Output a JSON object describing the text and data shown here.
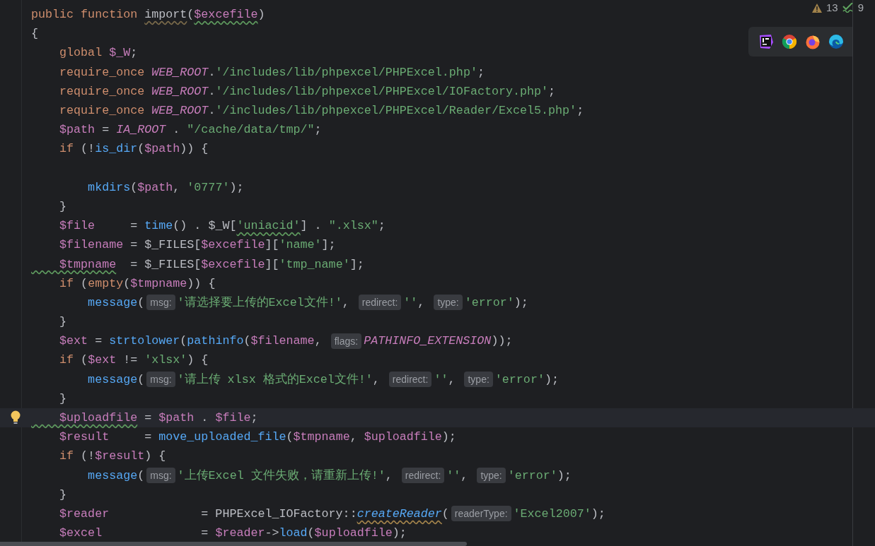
{
  "inspections": {
    "warnings": "13",
    "checks": "9"
  },
  "lines": [
    {
      "current": false,
      "tokens": [
        {
          "kind": "keyword",
          "text": "public function "
        },
        {
          "kind": "plain-weak",
          "text": "import"
        },
        {
          "kind": "plain",
          "text": "("
        },
        {
          "kind": "variable-typo",
          "text": "$excefile"
        },
        {
          "kind": "plain",
          "text": ")"
        }
      ]
    },
    {
      "current": false,
      "tokens": [
        {
          "kind": "plain",
          "text": "{"
        }
      ]
    },
    {
      "current": false,
      "tokens": [
        {
          "kind": "keyword",
          "text": "    global "
        },
        {
          "kind": "variable",
          "text": "$_W"
        },
        {
          "kind": "plain",
          "text": ";"
        }
      ]
    },
    {
      "current": false,
      "tokens": [
        {
          "kind": "keyword",
          "text": "    require_once "
        },
        {
          "kind": "constant",
          "text": "WEB_ROOT"
        },
        {
          "kind": "plain",
          "text": "."
        },
        {
          "kind": "string",
          "text": "'/includes/lib/phpexcel/PHPExcel.php'"
        },
        {
          "kind": "plain",
          "text": ";"
        }
      ]
    },
    {
      "current": false,
      "tokens": [
        {
          "kind": "keyword",
          "text": "    require_once "
        },
        {
          "kind": "constant",
          "text": "WEB_ROOT"
        },
        {
          "kind": "plain",
          "text": "."
        },
        {
          "kind": "string",
          "text": "'/includes/lib/phpexcel/PHPExcel/IOFactory.php'"
        },
        {
          "kind": "plain",
          "text": ";"
        }
      ]
    },
    {
      "current": false,
      "tokens": [
        {
          "kind": "keyword",
          "text": "    require_once "
        },
        {
          "kind": "constant",
          "text": "WEB_ROOT"
        },
        {
          "kind": "plain",
          "text": "."
        },
        {
          "kind": "string",
          "text": "'/includes/lib/phpexcel/PHPExcel/Reader/Excel5.php'"
        },
        {
          "kind": "plain",
          "text": ";"
        }
      ]
    },
    {
      "current": false,
      "tokens": [
        {
          "kind": "variable",
          "text": "    $path"
        },
        {
          "kind": "plain",
          "text": " = "
        },
        {
          "kind": "constant",
          "text": "IA_ROOT"
        },
        {
          "kind": "plain",
          "text": " . "
        },
        {
          "kind": "string",
          "text": "\"/cache/data/tmp/\""
        },
        {
          "kind": "plain",
          "text": ";"
        }
      ]
    },
    {
      "current": false,
      "tokens": [
        {
          "kind": "keyword",
          "text": "    if "
        },
        {
          "kind": "plain",
          "text": "(!"
        },
        {
          "kind": "function",
          "text": "is_dir"
        },
        {
          "kind": "plain",
          "text": "("
        },
        {
          "kind": "variable",
          "text": "$path"
        },
        {
          "kind": "plain",
          "text": ")) {"
        }
      ]
    },
    {
      "current": false
    },
    {
      "current": false,
      "tokens": [
        {
          "kind": "function",
          "text": "        mkdirs"
        },
        {
          "kind": "plain",
          "text": "("
        },
        {
          "kind": "variable",
          "text": "$path"
        },
        {
          "kind": "plain",
          "text": ", "
        },
        {
          "kind": "string",
          "text": "'0777'"
        },
        {
          "kind": "plain",
          "text": ");"
        }
      ]
    },
    {
      "current": false,
      "tokens": [
        {
          "kind": "plain",
          "text": "    }"
        }
      ]
    },
    {
      "current": false,
      "tokens": [
        {
          "kind": "variable",
          "text": "    $file"
        },
        {
          "kind": "plain",
          "text": "     = "
        },
        {
          "kind": "function",
          "text": "time"
        },
        {
          "kind": "plain",
          "text": "() . $_W["
        },
        {
          "kind": "string-typo",
          "text": "'uniacid'"
        },
        {
          "kind": "plain",
          "text": "] . "
        },
        {
          "kind": "string",
          "text": "\".xlsx\""
        },
        {
          "kind": "plain",
          "text": ";"
        }
      ]
    },
    {
      "current": false,
      "tokens": [
        {
          "kind": "variable",
          "text": "    $filename"
        },
        {
          "kind": "plain",
          "text": " = $_FILES["
        },
        {
          "kind": "variable",
          "text": "$excefile"
        },
        {
          "kind": "plain",
          "text": "]["
        },
        {
          "kind": "string",
          "text": "'name'"
        },
        {
          "kind": "plain",
          "text": "];"
        }
      ]
    },
    {
      "current": false,
      "tokens": [
        {
          "kind": "variable-typo",
          "text": "    $tmpname"
        },
        {
          "kind": "plain",
          "text": "  = $_FILES["
        },
        {
          "kind": "variable",
          "text": "$excefile"
        },
        {
          "kind": "plain",
          "text": "]["
        },
        {
          "kind": "string",
          "text": "'tmp_name'"
        },
        {
          "kind": "plain",
          "text": "];"
        }
      ]
    },
    {
      "current": false,
      "tokens": [
        {
          "kind": "keyword",
          "text": "    if "
        },
        {
          "kind": "plain",
          "text": "("
        },
        {
          "kind": "keyword",
          "text": "empty"
        },
        {
          "kind": "plain",
          "text": "("
        },
        {
          "kind": "variable",
          "text": "$tmpname"
        },
        {
          "kind": "plain",
          "text": ")) {"
        }
      ]
    },
    {
      "current": false,
      "tokens": [
        {
          "kind": "function",
          "text": "        message"
        },
        {
          "kind": "plain",
          "text": "("
        },
        {
          "kind": "hint",
          "text": "msg:"
        },
        {
          "kind": "string",
          "text": "'请选择要上传的Excel文件!'"
        },
        {
          "kind": "plain",
          "text": ", "
        },
        {
          "kind": "hint",
          "text": "redirect:"
        },
        {
          "kind": "string",
          "text": "''"
        },
        {
          "kind": "plain",
          "text": ", "
        },
        {
          "kind": "hint",
          "text": "type:"
        },
        {
          "kind": "string",
          "text": "'error'"
        },
        {
          "kind": "plain",
          "text": ");"
        }
      ]
    },
    {
      "current": false,
      "tokens": [
        {
          "kind": "plain",
          "text": "    }"
        }
      ]
    },
    {
      "current": false,
      "tokens": [
        {
          "kind": "variable",
          "text": "    $ext"
        },
        {
          "kind": "plain",
          "text": " = "
        },
        {
          "kind": "function",
          "text": "strtolower"
        },
        {
          "kind": "plain",
          "text": "("
        },
        {
          "kind": "function",
          "text": "pathinfo"
        },
        {
          "kind": "plain",
          "text": "("
        },
        {
          "kind": "variable",
          "text": "$filename"
        },
        {
          "kind": "plain",
          "text": ", "
        },
        {
          "kind": "hint",
          "text": "flags:"
        },
        {
          "kind": "constant",
          "text": "PATHINFO_EXTENSION"
        },
        {
          "kind": "plain",
          "text": "));"
        }
      ]
    },
    {
      "current": false,
      "tokens": [
        {
          "kind": "keyword",
          "text": "    if "
        },
        {
          "kind": "plain",
          "text": "("
        },
        {
          "kind": "variable",
          "text": "$ext"
        },
        {
          "kind": "plain",
          "text": " != "
        },
        {
          "kind": "string",
          "text": "'xlsx'"
        },
        {
          "kind": "plain",
          "text": ") {"
        }
      ]
    },
    {
      "current": false,
      "tokens": [
        {
          "kind": "function",
          "text": "        message"
        },
        {
          "kind": "plain",
          "text": "("
        },
        {
          "kind": "hint",
          "text": "msg:"
        },
        {
          "kind": "string",
          "text": "'请上传 xlsx 格式的Excel文件!'"
        },
        {
          "kind": "plain",
          "text": ", "
        },
        {
          "kind": "hint",
          "text": "redirect:"
        },
        {
          "kind": "string",
          "text": "''"
        },
        {
          "kind": "plain",
          "text": ", "
        },
        {
          "kind": "hint",
          "text": "type:"
        },
        {
          "kind": "string",
          "text": "'error'"
        },
        {
          "kind": "plain",
          "text": ");"
        }
      ]
    },
    {
      "current": false,
      "tokens": [
        {
          "kind": "plain",
          "text": "    }"
        }
      ]
    },
    {
      "current": true,
      "tokens": [
        {
          "kind": "variable-typo",
          "text": "    $uploadfile"
        },
        {
          "kind": "plain",
          "text": " = "
        },
        {
          "kind": "variable",
          "text": "$path"
        },
        {
          "kind": "plain",
          "text": " . "
        },
        {
          "kind": "variable",
          "text": "$file"
        },
        {
          "kind": "plain",
          "text": ";"
        }
      ]
    },
    {
      "current": false,
      "tokens": [
        {
          "kind": "variable",
          "text": "    $result"
        },
        {
          "kind": "plain",
          "text": "     = "
        },
        {
          "kind": "function",
          "text": "move_uploaded_file"
        },
        {
          "kind": "plain",
          "text": "("
        },
        {
          "kind": "variable",
          "text": "$tmpname"
        },
        {
          "kind": "plain",
          "text": ", "
        },
        {
          "kind": "variable",
          "text": "$uploadfile"
        },
        {
          "kind": "plain",
          "text": ");"
        }
      ]
    },
    {
      "current": false,
      "tokens": [
        {
          "kind": "keyword",
          "text": "    if "
        },
        {
          "kind": "plain",
          "text": "(!"
        },
        {
          "kind": "variable",
          "text": "$result"
        },
        {
          "kind": "plain",
          "text": ") {"
        }
      ]
    },
    {
      "current": false,
      "tokens": [
        {
          "kind": "function",
          "text": "        message"
        },
        {
          "kind": "plain",
          "text": "("
        },
        {
          "kind": "hint",
          "text": "msg:"
        },
        {
          "kind": "string",
          "text": "'上传Excel 文件失败，请重新上传!'"
        },
        {
          "kind": "plain",
          "text": ", "
        },
        {
          "kind": "hint",
          "text": "redirect:"
        },
        {
          "kind": "string",
          "text": "''"
        },
        {
          "kind": "plain",
          "text": ", "
        },
        {
          "kind": "hint",
          "text": "type:"
        },
        {
          "kind": "string",
          "text": "'error'"
        },
        {
          "kind": "plain",
          "text": ");"
        }
      ]
    },
    {
      "current": false,
      "tokens": [
        {
          "kind": "plain",
          "text": "    }"
        }
      ]
    },
    {
      "current": false,
      "tokens": [
        {
          "kind": "variable",
          "text": "    $reader"
        },
        {
          "kind": "plain",
          "text": "             = PHPExcel_IOFactory::"
        },
        {
          "kind": "function-static",
          "text": "createReader"
        },
        {
          "kind": "plain",
          "text": "("
        },
        {
          "kind": "hint",
          "text": "readerType:"
        },
        {
          "kind": "string",
          "text": "'Excel2007'"
        },
        {
          "kind": "plain",
          "text": ");"
        }
      ]
    },
    {
      "current": false,
      "tokens": [
        {
          "kind": "variable",
          "text": "    $excel"
        },
        {
          "kind": "plain",
          "text": "              = "
        },
        {
          "kind": "variable",
          "text": "$reader"
        },
        {
          "kind": "plain",
          "text": "->"
        },
        {
          "kind": "function",
          "text": "load"
        },
        {
          "kind": "plain",
          "text": "("
        },
        {
          "kind": "variable",
          "text": "$uploadfile"
        },
        {
          "kind": "plain",
          "text": ");"
        }
      ]
    }
  ]
}
